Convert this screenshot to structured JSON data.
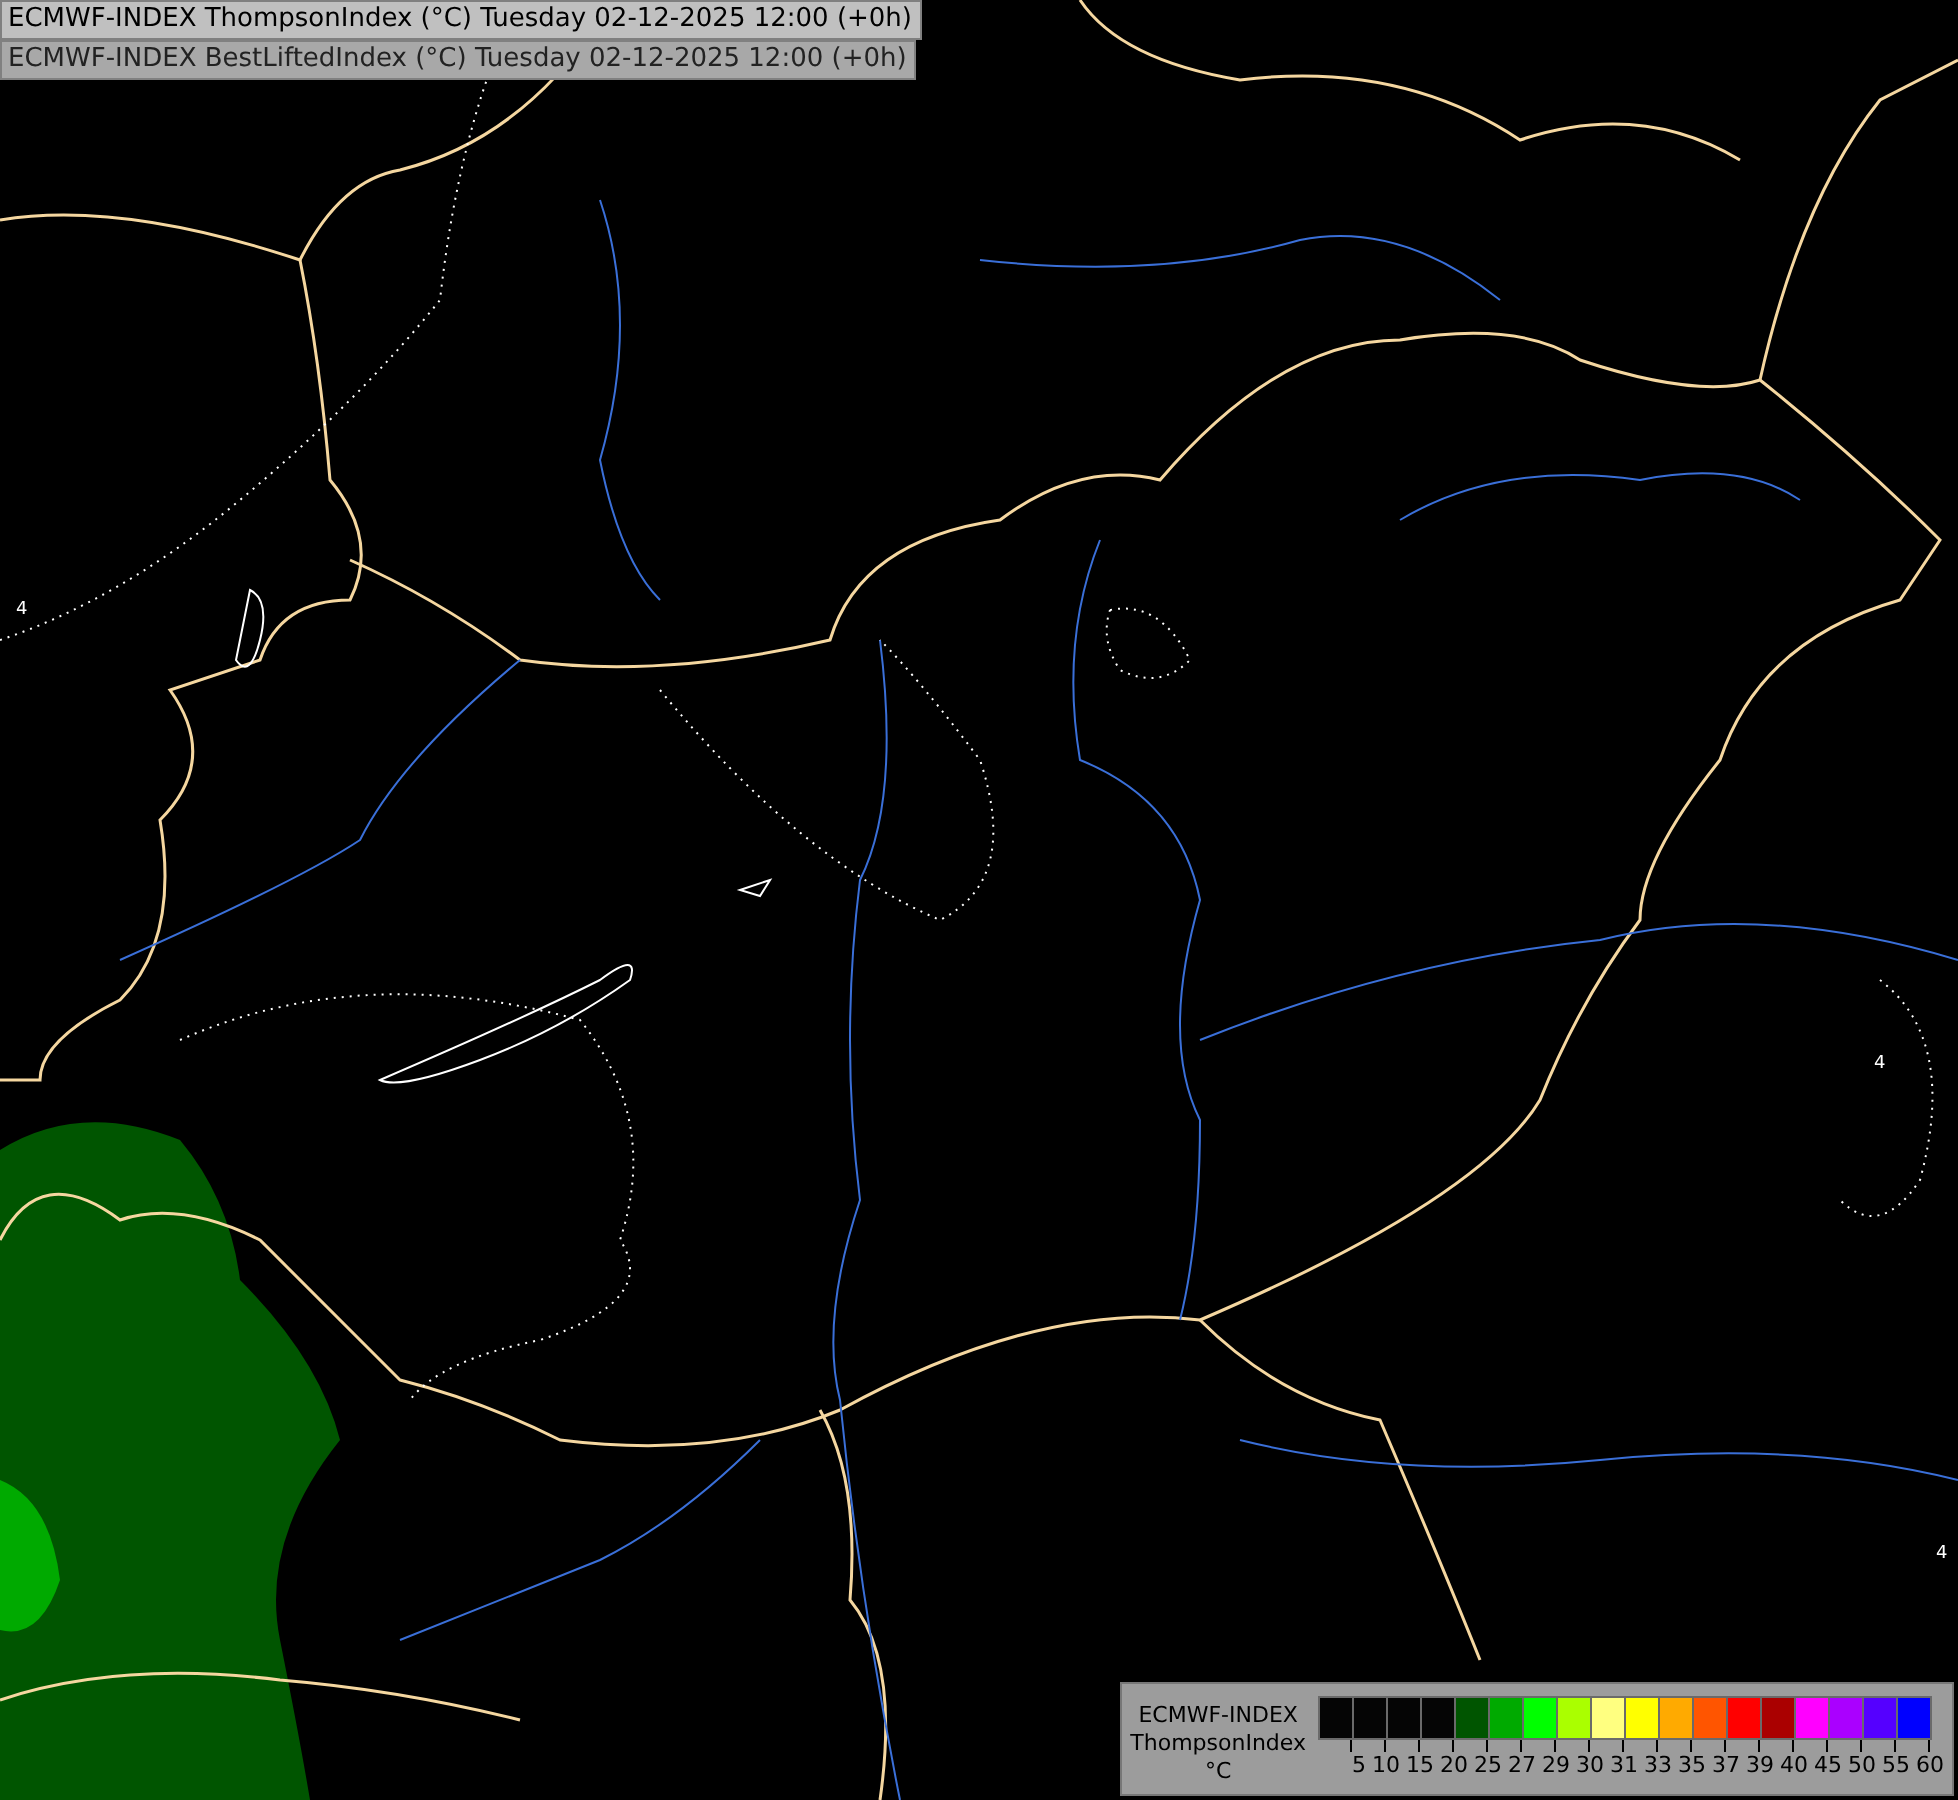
{
  "titles": [
    "ECMWF-INDEX ThompsonIndex (°C) Tuesday 02-12-2025 12:00 (+0h)",
    "ECMWF-INDEX BestLiftedIndex (°C) Tuesday 02-12-2025 12:00 (+0h)"
  ],
  "contour_labels": [
    "4",
    "4",
    "4"
  ],
  "legend": {
    "title_lines": [
      "ECMWF-INDEX",
      "ThompsonIndex",
      "°C"
    ],
    "bins": [
      {
        "color": "#050505",
        "label": "5"
      },
      {
        "color": "#050505",
        "label": "10"
      },
      {
        "color": "#050505",
        "label": "15"
      },
      {
        "color": "#050505",
        "label": "20"
      },
      {
        "color": "#005500",
        "label": "25"
      },
      {
        "color": "#00aa00",
        "label": "27"
      },
      {
        "color": "#00ff00",
        "label": "29"
      },
      {
        "color": "#aaff00",
        "label": "30"
      },
      {
        "color": "#ffff80",
        "label": "31"
      },
      {
        "color": "#ffff00",
        "label": "33"
      },
      {
        "color": "#ffaa00",
        "label": "35"
      },
      {
        "color": "#ff5500",
        "label": "37"
      },
      {
        "color": "#ff0000",
        "label": "39"
      },
      {
        "color": "#aa0000",
        "label": "40"
      },
      {
        "color": "#ff00ff",
        "label": "45"
      },
      {
        "color": "#aa00ff",
        "label": "50"
      },
      {
        "color": "#5500ff",
        "label": "55"
      },
      {
        "color": "#0000ff",
        "label": "60"
      }
    ]
  }
}
